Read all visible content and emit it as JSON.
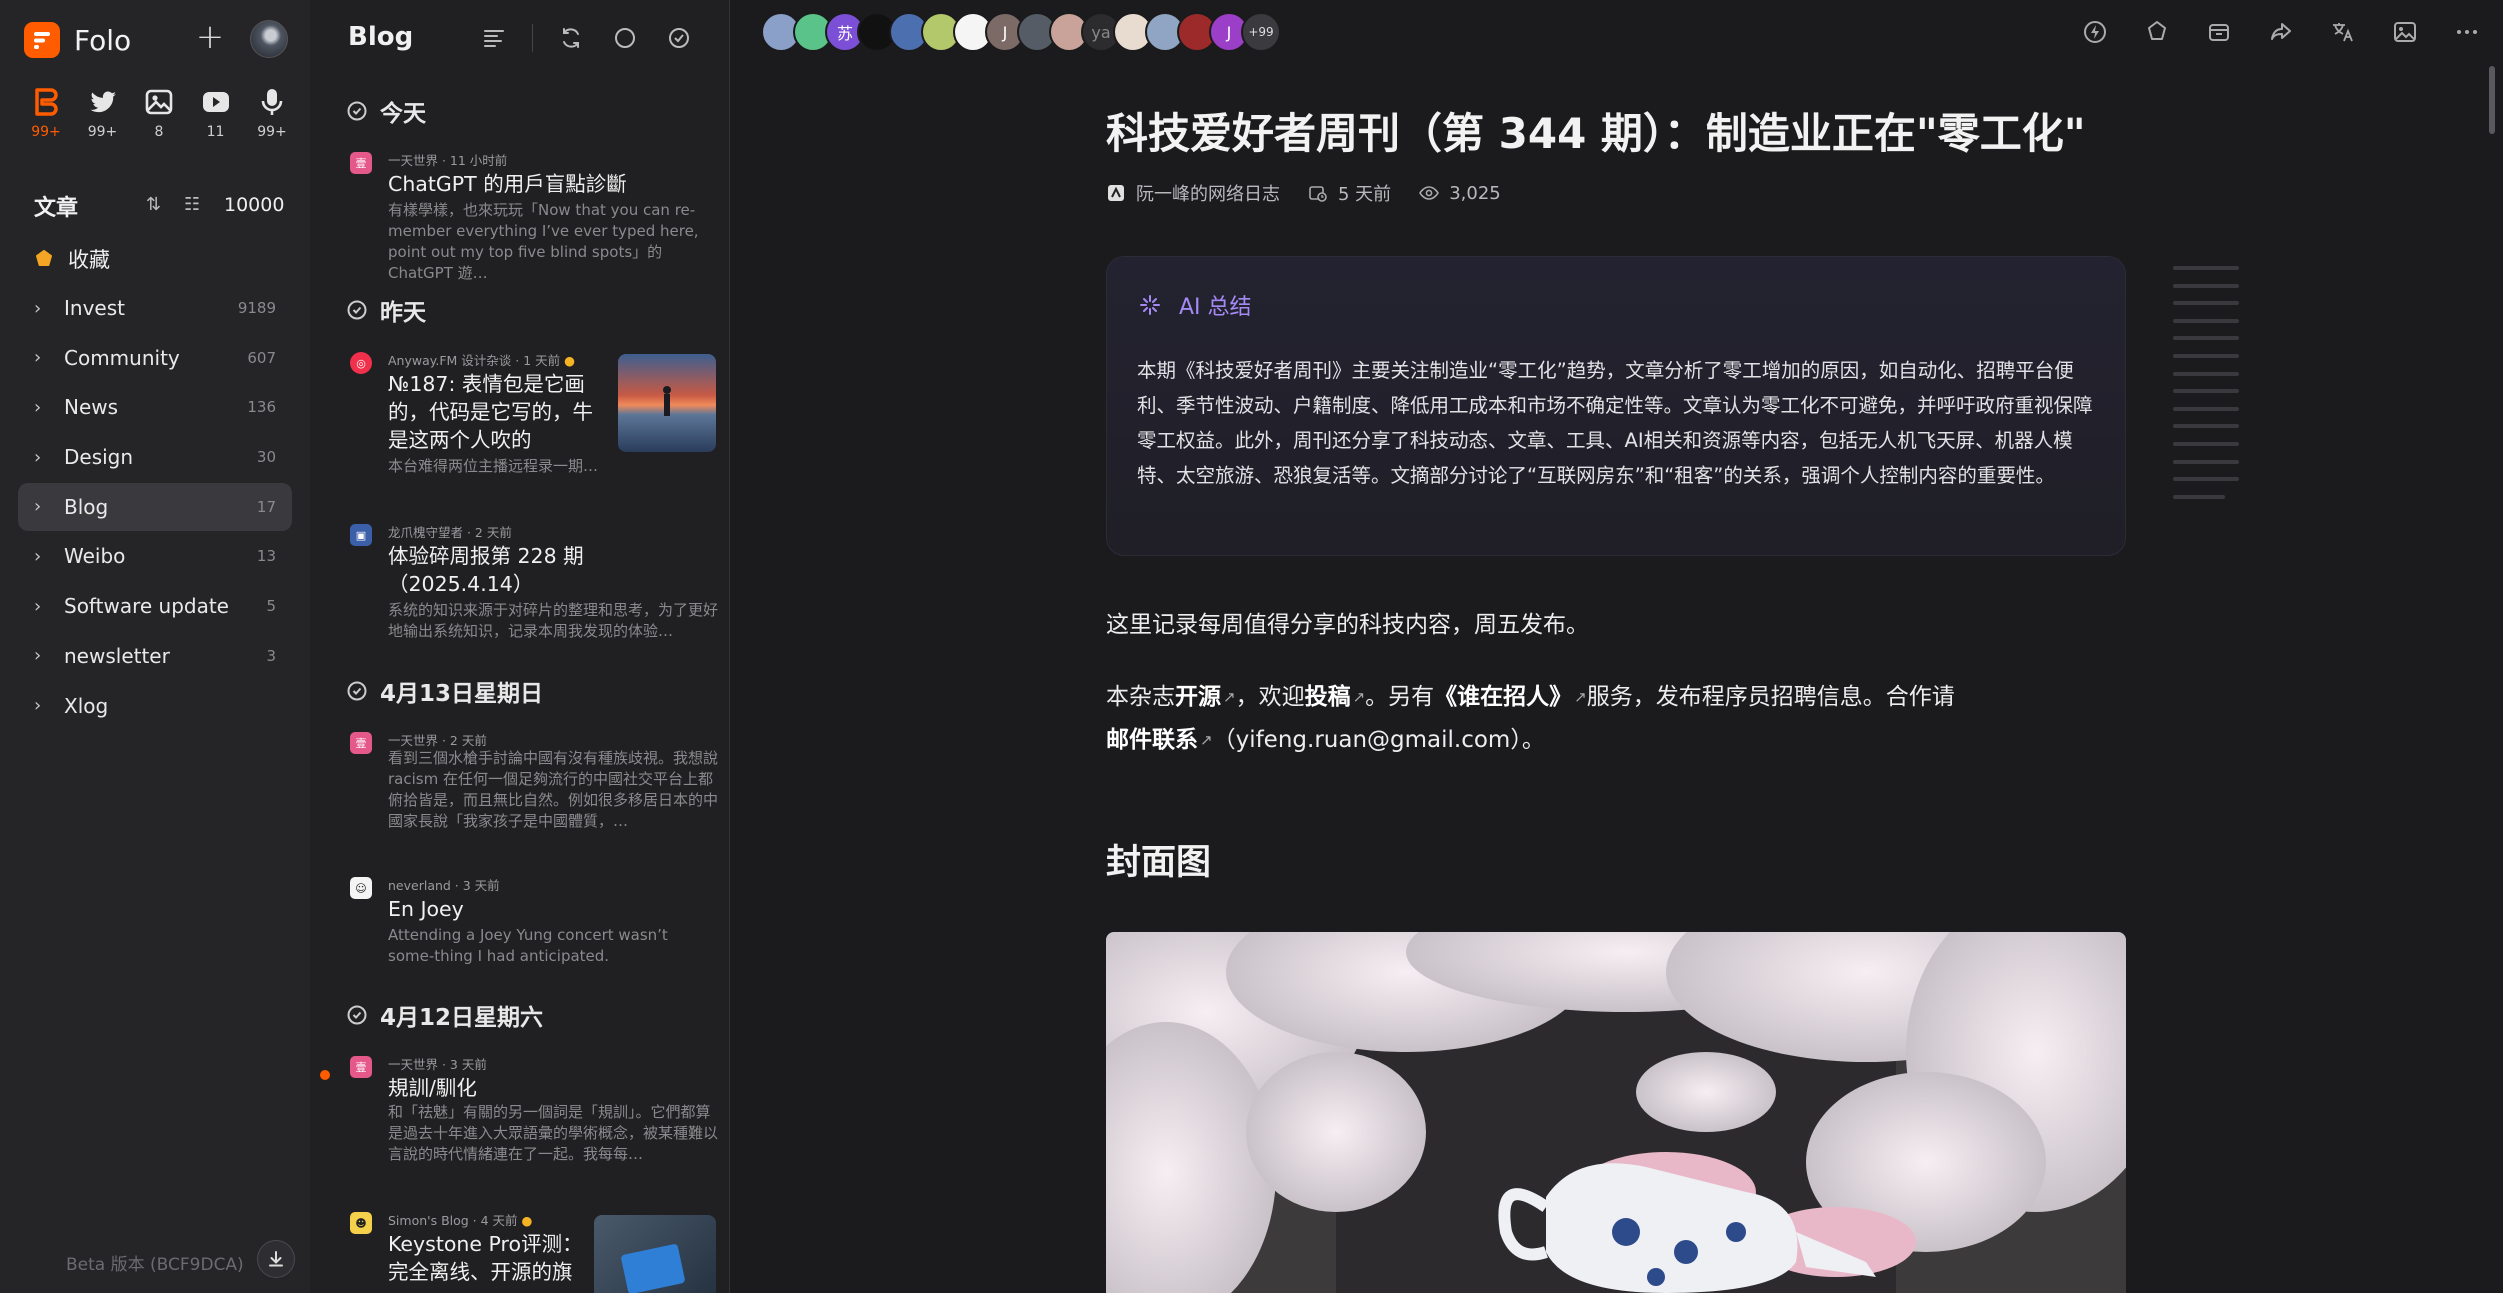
{
  "app": {
    "name": "Folo"
  },
  "views": [
    {
      "name": "articles",
      "icon": "article-icon",
      "count": "99+",
      "active": true
    },
    {
      "name": "social",
      "icon": "twitter-icon",
      "count": "99+"
    },
    {
      "name": "pictures",
      "icon": "image-icon",
      "count": "8"
    },
    {
      "name": "videos",
      "icon": "video-icon",
      "count": "11"
    },
    {
      "name": "audio",
      "icon": "microphone-icon",
      "count": "99+"
    }
  ],
  "sidebar": {
    "section_title": "文章",
    "unread_total": "10000",
    "starred_label": "收藏",
    "categories": [
      {
        "label": "Invest",
        "count": "9189"
      },
      {
        "label": "Community",
        "count": "607"
      },
      {
        "label": "News",
        "count": "136"
      },
      {
        "label": "Design",
        "count": "30"
      },
      {
        "label": "Blog",
        "count": "17",
        "active": true
      },
      {
        "label": "Weibo",
        "count": "13"
      },
      {
        "label": "Software update",
        "count": "5"
      },
      {
        "label": "newsletter",
        "count": "3"
      },
      {
        "label": "Xlog",
        "count": ""
      }
    ],
    "version": "Beta 版本 (BCF9DCA)"
  },
  "entry_list": {
    "title": "Blog",
    "groups": {
      "today": "今天",
      "yesterday": "昨天",
      "apr13": "4月13日星期日",
      "apr12": "4月12日星期六"
    },
    "entries": [
      {
        "meta": "一天世界 · 11 小时前",
        "title": "ChatGPT 的用戶盲點診斷",
        "desc": "有樣學樣，也來玩玩「Now that you can re-member everything I’ve ever typed here, point out my top five blind spots」的 ChatGPT 遊…"
      },
      {
        "meta": "Anyway.FM 设计杂谈 · 1 天前",
        "title": "№187: 表情包是它画的，代码是它写的，牛是这两个人吹的",
        "desc": "本台难得两位主播远程录一期…"
      },
      {
        "meta": "龙爪槐守望者 · 2 天前",
        "title": "体验碎周报第 228 期（2025.4.14）",
        "desc": "系统的知识来源于对碎片的整理和思考，为了更好地输出系统知识，记录本周我发现的体验…"
      },
      {
        "meta": "一天世界 · 2 天前",
        "title": "",
        "desc": "看到三個水槍手討論中國有沒有種族歧視。我想說 racism 在任何一個足夠流行的中國社交平台上都俯拾皆是，而且無比自然。例如很多移居日本的中國家長說「我家孩子是中國體質，…"
      },
      {
        "meta": "neverland · 3 天前",
        "title": "En Joey",
        "desc": "Attending a Joey Yung concert wasn’t some-thing I had anticipated."
      },
      {
        "meta": "一天世界 · 3 天前",
        "title": "規訓/馴化",
        "desc": "和「祛魅」有關的另一個詞是「規訓」。它們都算是過去十年進入大眾語彙的學術概念，被某種難以言說的時代情緒連在了一起。我每每…"
      },
      {
        "meta": "Simon's Blog · 4 天前",
        "title": "Keystone Pro评测：完全离线、开源的旗",
        "desc": ""
      }
    ]
  },
  "reader": {
    "avatars": [
      {
        "letter": "",
        "color": "#8aa0c8"
      },
      {
        "letter": "",
        "color": "#59c38a"
      },
      {
        "letter": "苏",
        "color": "#7b4fd6"
      },
      {
        "letter": "",
        "color": "#111111"
      },
      {
        "letter": "",
        "color": "#4c6fb0"
      },
      {
        "letter": "",
        "color": "#b3c86a"
      },
      {
        "letter": "",
        "color": "#f5f5f5"
      },
      {
        "letter": "J",
        "color": "#7b6a66"
      },
      {
        "letter": "",
        "color": "#555c66"
      },
      {
        "letter": "",
        "color": "#c9a39a"
      },
      {
        "letter": "ya",
        "color": "#2c2c2f"
      },
      {
        "letter": "",
        "color": "#e8dcd0"
      },
      {
        "letter": "",
        "color": "#8fa5c3"
      },
      {
        "letter": "",
        "color": "#9c2a2a"
      },
      {
        "letter": "J",
        "color": "#9b3fc8"
      }
    ],
    "avatars_more": "+99",
    "actions": [
      "ai-summary-icon",
      "star-icon",
      "archive-icon",
      "share-icon",
      "translate-icon",
      "image-gallery-icon",
      "more-icon"
    ],
    "article": {
      "title": "科技爱好者周刊（第 344 期）：制造业正在\"零工化\"",
      "author": "阮一峰的网络日志",
      "time": "5 天前",
      "views": "3,025",
      "ai_label": "AI 总结",
      "ai_summary": "本期《科技爱好者周刊》主要关注制造业“零工化”趋势，文章分析了零工增加的原因，如自动化、招聘平台便利、季节性波动、户籍制度、降低用工成本和市场不确定性等。文章认为零工化不可避免，并呼吁政府重视保障零工权益。此外，周刊还分享了科技动态、文章、工具、AI相关和资源等内容，包括无人机飞天屏、机器人模特、太空旅游、恐狼复活等。文摘部分讨论了“互联网房东”和“租客”的关系，强调个人控制内容的重要性。",
      "intro": "这里记录每周值得分享的科技内容，周五发布。",
      "p2": {
        "t1": "本杂志",
        "l1": "开源",
        "t2": "，欢迎",
        "l2": "投稿",
        "t3": "。另有",
        "l3": "《谁在招人》",
        "t4": "服务，发布程序员招聘信息。合作请",
        "l4": "邮件联系",
        "t5": "（yifeng.ruan@gmail.com）。"
      },
      "section_heading": "封面图"
    }
  }
}
